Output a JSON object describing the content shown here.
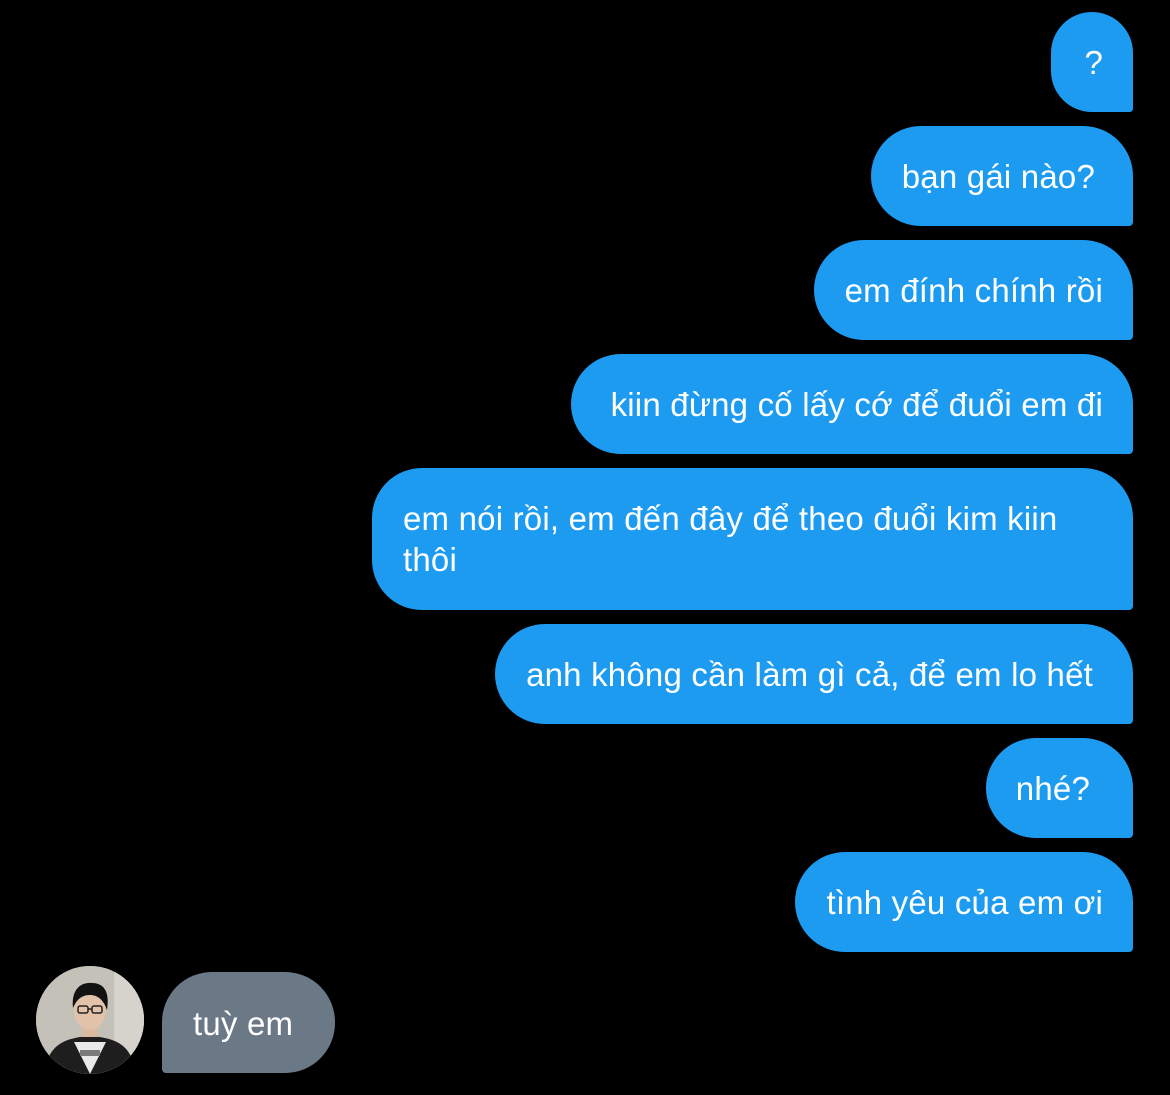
{
  "conversation": {
    "sent_messages": [
      {
        "text": "?"
      },
      {
        "text": "bạn gái nào?"
      },
      {
        "text": "em đính chính rồi"
      },
      {
        "text": "kiin đừng cố lấy cớ để đuổi em đi"
      },
      {
        "text": "em nói rồi, em đến đây để theo đuổi kim kiin thôi"
      },
      {
        "text": "anh không cần làm gì cả, để em lo hết"
      },
      {
        "text": "nhé?"
      },
      {
        "text": "tình yêu của em ơi"
      }
    ],
    "received_messages": [
      {
        "text": "tuỳ em"
      }
    ],
    "colors": {
      "background": "#000000",
      "sent_bubble": "#1d9bf0",
      "received_bubble": "#6b7886",
      "text": "#ffffff"
    },
    "avatar": {
      "icon": "user-avatar-photo"
    }
  }
}
